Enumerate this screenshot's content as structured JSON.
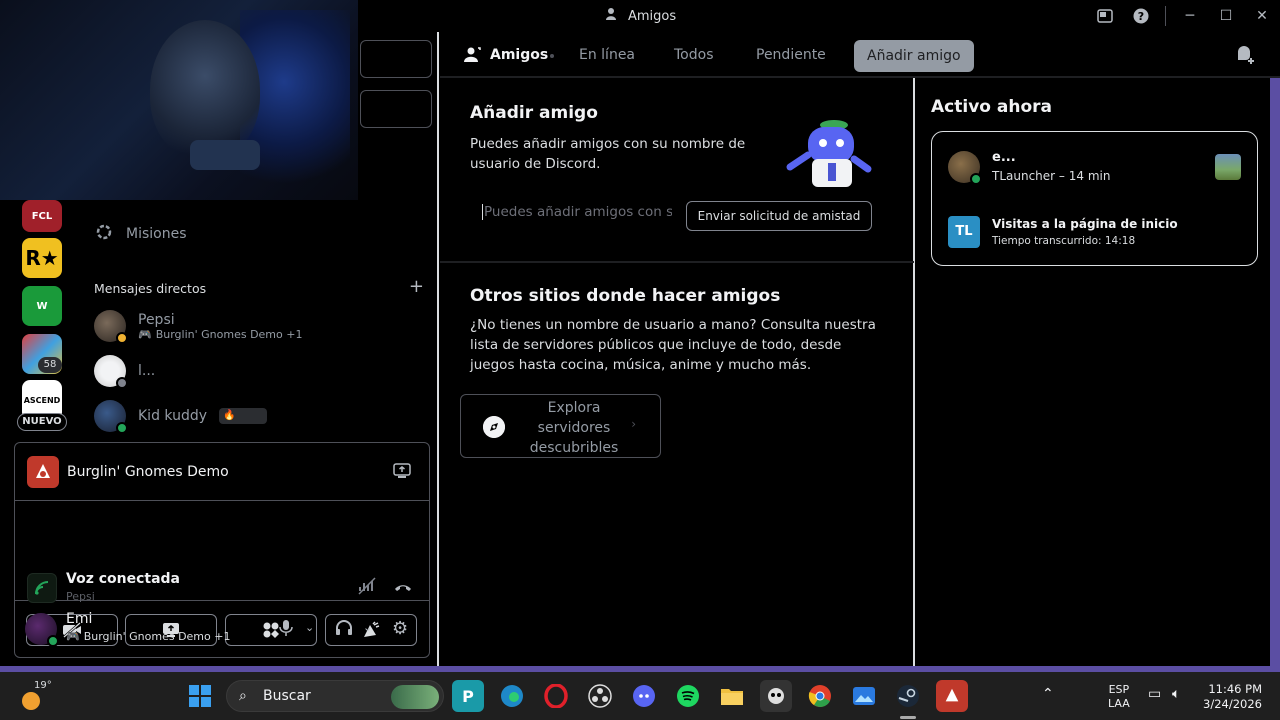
{
  "window": {
    "title": "Amigos",
    "controls": [
      "cast-icon",
      "help-icon",
      "minimize-icon",
      "maximize-icon",
      "close-icon"
    ]
  },
  "rail": {
    "badge": "58",
    "nuevo_label": "NUEVO"
  },
  "channel_list": {
    "quests_label": "Misiones",
    "dm_header": "Mensajes directos",
    "dms": [
      {
        "name": "Pepsi",
        "activity": "Burglin' Gnomes Demo +1",
        "status": "idle"
      },
      {
        "name": "l...",
        "activity": "",
        "status": "offline"
      },
      {
        "name": "Kid kuddy",
        "activity": "",
        "status": "online"
      }
    ]
  },
  "panel": {
    "game_name": "Burglin' Gnomes Demo",
    "voice_title": "Voz conectada",
    "voice_channel": "Pepsi",
    "user_name": "Emi",
    "user_activity": "Burglin' Gnomes Demo +1"
  },
  "topnav": {
    "friends_label": "Amigos",
    "tabs": [
      "En línea",
      "Todos",
      "Pendiente"
    ],
    "add_friend_label": "Añadir amigo"
  },
  "add_friend": {
    "title": "Añadir amigo",
    "description": "Puedes añadir amigos con su nombre de usuario de Discord.",
    "input_placeholder": "Puedes añadir amigos con su nombre de usuario de Discord",
    "send_button": "Enviar solicitud de amistad"
  },
  "other_places": {
    "title": "Otros sitios donde hacer amigos",
    "description": "¿No tienes un nombre de usuario a mano? Consulta nuestra lista de servidores públicos que incluye de todo, desde juegos hasta cocina, música, anime y mucho más.",
    "explore_button": "Explora servidores descubribles"
  },
  "active_now": {
    "title": "Activo ahora",
    "items": [
      {
        "name": "e...",
        "activity": "TLauncher – 14 min"
      },
      {
        "icon_text": "TL",
        "name": "Visitas a la página de inicio",
        "activity": "Tiempo transcurrido: 14:18"
      }
    ]
  },
  "taskbar": {
    "weather_temp": "19°",
    "search_label": "Buscar",
    "language": "ESP",
    "keyboard": "LAA",
    "time": "11:46 PM",
    "date": "3/24/2026"
  },
  "colors": {
    "accent_purple": "#5b4ea3",
    "online_green": "#23a55a",
    "idle_yellow": "#f0b232"
  }
}
